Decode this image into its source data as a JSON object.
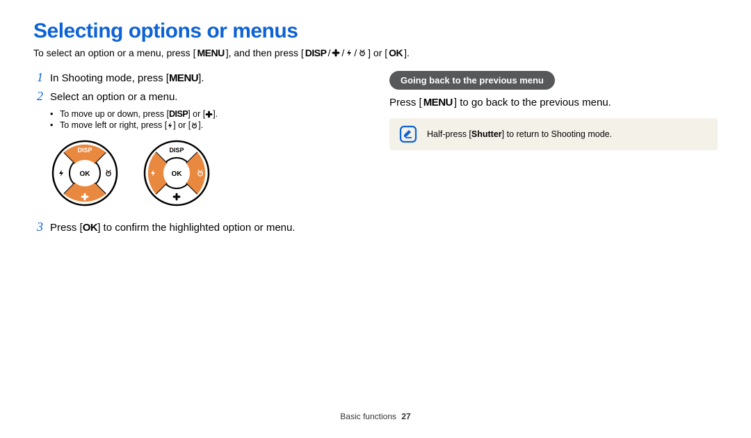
{
  "title": "Selecting options or menus",
  "intro": {
    "a": "To select an option or a menu, press [",
    "menu": "MENU",
    "b": "], and then press [",
    "disp": "DISP",
    "sep1": "/",
    "sep2": "/",
    "sep3": "/",
    "c": "] or [",
    "ok": "OK",
    "d": "]."
  },
  "steps": {
    "s1": {
      "num": "1",
      "a": "In Shooting mode, press [",
      "menu": "MENU",
      "b": "]."
    },
    "s2": {
      "num": "2",
      "text": "Select an option or a menu.",
      "bullets": {
        "b1a": "To move up or down, press [",
        "b1disp": "DISP",
        "b1b": "] or [",
        "b1c": "].",
        "b2a": "To move left or right, press [",
        "b2b": "] or [",
        "b2c": "]."
      }
    },
    "s3": {
      "num": "3",
      "a": "Press [",
      "ok": "OK",
      "b": "] to confirm the highlighted option or menu."
    }
  },
  "wheel": {
    "disp": "DISP",
    "ok": "OK"
  },
  "right": {
    "heading": "Going back to the previous menu",
    "para": {
      "a": "Press [",
      "menu": "MENU",
      "b": "] to go back to the previous menu."
    },
    "note": {
      "a": "Half-press [",
      "shutter": "Shutter",
      "b": "] to return to Shooting mode."
    }
  },
  "footer": {
    "section": "Basic functions",
    "page": "27"
  }
}
